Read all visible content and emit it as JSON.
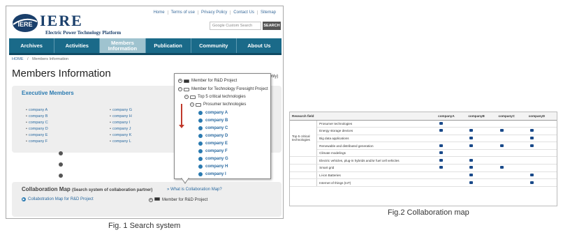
{
  "fig1": {
    "logo": {
      "text": "IERE",
      "mark_text": "IERE",
      "subtitle": "Electric Power Technology Platform"
    },
    "top_links": [
      "Home",
      "Terms of use",
      "Privacy Policy",
      "Contact Us",
      "Sitemap"
    ],
    "search": {
      "placeholder": "Custom Search",
      "brand": "Google",
      "button": "SEARCH"
    },
    "nav": [
      {
        "label": "Archives",
        "active": false
      },
      {
        "label": "Activities",
        "active": false
      },
      {
        "label": "Members\nInformation",
        "active": true
      },
      {
        "label": "Publication",
        "active": false
      },
      {
        "label": "Community",
        "active": false
      },
      {
        "label": "About Us",
        "active": false
      }
    ],
    "breadcrumb": {
      "home": "HOME",
      "sep": "/",
      "current": "Members Information"
    },
    "page_title": "Members Information",
    "only_text": "Only)",
    "executive": {
      "title": "Executive Members",
      "left": [
        "company A",
        "company B",
        "company C",
        "company D",
        "company E",
        "company F"
      ],
      "right": [
        "company G",
        "company H",
        "company I",
        "company J",
        "company K",
        "company L"
      ]
    },
    "popup": {
      "rows": [
        {
          "kind": "plus",
          "label": "Member for R&D Project"
        },
        {
          "kind": "minus",
          "label": "Member for Technology Foresight Project"
        },
        {
          "kind": "minus",
          "label": "Top 5 critical technologies"
        },
        {
          "kind": "minus",
          "label": "Prosumer technologies"
        }
      ],
      "companies": [
        "company A",
        "company B",
        "company C",
        "company D",
        "company E",
        "company F",
        "company G",
        "company H",
        "company I"
      ]
    },
    "collab": {
      "title": "Collaboration Map",
      "subtitle": "(Search system of collaboration partner)",
      "what": "» What is Collaboration Map?",
      "link": "Collabotration Map for R&D Project",
      "rd_label": "Member for R&D Project"
    },
    "caption": "Fig. 1 Search system"
  },
  "fig2": {
    "headers": [
      "Research field",
      "",
      "companyA",
      "companyB",
      "companyC",
      "companyD"
    ],
    "group_label": "Top 5 critical technologies",
    "rows": [
      {
        "field": "Prosumer technologies",
        "marks": [
          true,
          false,
          false,
          false
        ],
        "group": true
      },
      {
        "field": "Energy storage devices",
        "marks": [
          true,
          true,
          true,
          true
        ],
        "group": true
      },
      {
        "field": "Big data applications",
        "marks": [
          false,
          true,
          false,
          true
        ],
        "group": true
      },
      {
        "field": "Renewable and distributed generation",
        "marks": [
          true,
          true,
          true,
          true
        ],
        "group": true
      },
      {
        "field": "Climate modelings",
        "marks": [
          true,
          false,
          false,
          false
        ],
        "group": true
      },
      {
        "field": "Electric vehicles, plug-in hybrids and/or fuel cell vehicles",
        "marks": [
          true,
          true,
          false,
          false
        ],
        "group": false
      },
      {
        "field": "Smart grid",
        "marks": [
          true,
          true,
          true,
          false
        ],
        "group": false
      },
      {
        "field": "Li-ion Batteries",
        "marks": [
          false,
          true,
          false,
          true
        ],
        "group": false
      },
      {
        "field": "Internet of things (IoT)",
        "marks": [
          false,
          true,
          false,
          true
        ],
        "group": false
      }
    ],
    "caption": "Fig.2 Collaboration map"
  }
}
